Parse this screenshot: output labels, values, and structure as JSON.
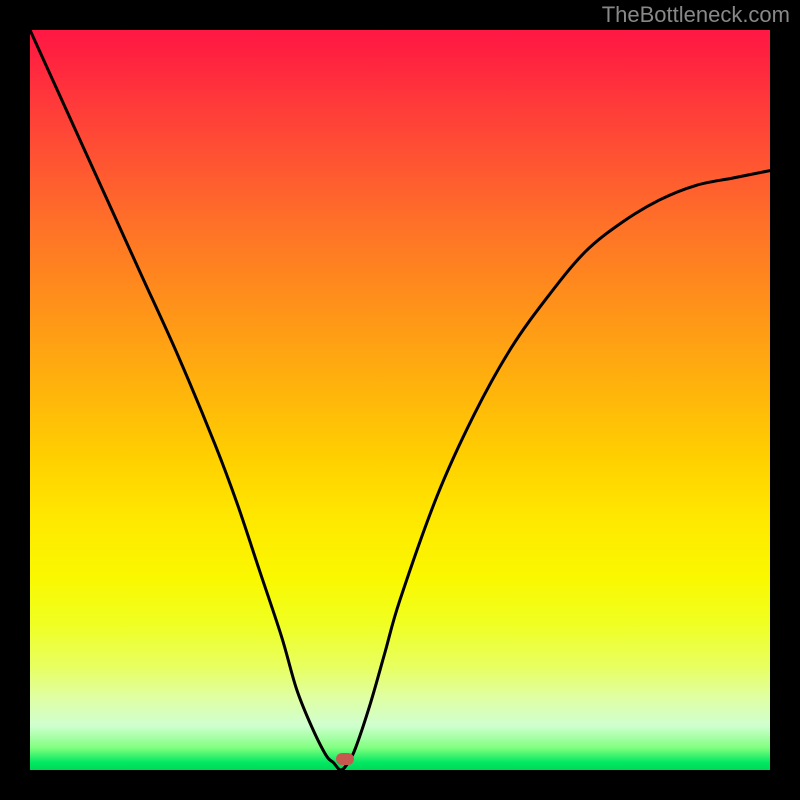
{
  "watermark": "TheBottleneck.com",
  "chart_data": {
    "type": "line",
    "title": "",
    "xlabel": "",
    "ylabel": "",
    "xlim": [
      0,
      100
    ],
    "ylim": [
      0,
      100
    ],
    "gradient": {
      "top_color": "#ff1844",
      "mid_color": "#ffd000",
      "bottom_color": "#00d858"
    },
    "series": [
      {
        "name": "bottleneck-curve",
        "x": [
          0,
          5,
          10,
          15,
          20,
          25,
          28,
          31,
          34,
          36,
          38,
          40,
          41,
          42,
          43,
          44,
          46,
          48,
          50,
          55,
          60,
          65,
          70,
          75,
          80,
          85,
          90,
          95,
          100
        ],
        "values": [
          100,
          89,
          78,
          67,
          56,
          44,
          36,
          27,
          18,
          11,
          6,
          2,
          1,
          0,
          1,
          3,
          9,
          16,
          23,
          37,
          48,
          57,
          64,
          70,
          74,
          77,
          79,
          80,
          81
        ]
      }
    ],
    "marker": {
      "x": 42.5,
      "y": 1.5,
      "color": "#c65850"
    }
  },
  "colors": {
    "background": "#000000",
    "watermark": "#888888",
    "curve": "#000000",
    "marker": "#c65850"
  }
}
